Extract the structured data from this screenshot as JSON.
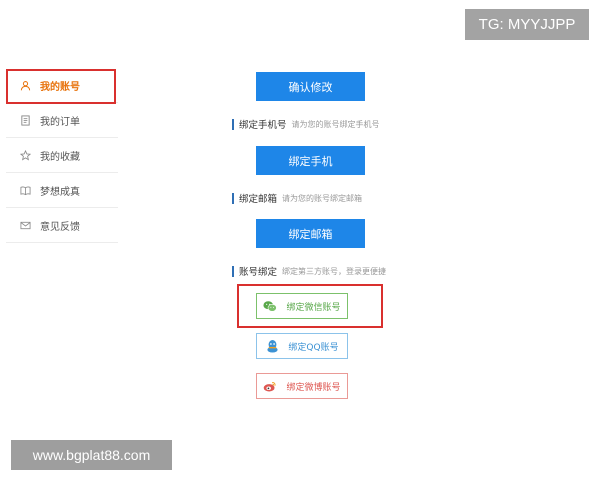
{
  "watermark": {
    "top": "TG: MYYJJPP",
    "bottom": "www.bgplat88.com"
  },
  "sidebar": {
    "items": [
      {
        "label": "我的账号",
        "icon": "user-icon",
        "active": true
      },
      {
        "label": "我的订单",
        "icon": "document-icon",
        "active": false
      },
      {
        "label": "我的收藏",
        "icon": "star-icon",
        "active": false
      },
      {
        "label": "梦想成真",
        "icon": "book-icon",
        "active": false
      },
      {
        "label": "意见反馈",
        "icon": "mail-icon",
        "active": false
      }
    ]
  },
  "main": {
    "confirm_button": "确认修改",
    "phone": {
      "title": "绑定手机号",
      "hint": "请为您的账号绑定手机号",
      "button": "绑定手机"
    },
    "email": {
      "title": "绑定邮箱",
      "hint": "请为您的账号绑定邮箱",
      "button": "绑定邮箱"
    },
    "social": {
      "title": "账号绑定",
      "hint": "绑定第三方账号，登录更便捷",
      "wechat": "绑定微信账号",
      "qq": "绑定QQ账号",
      "weibo": "绑定微博账号"
    }
  },
  "colors": {
    "accent_blue": "#1e86e8",
    "active_orange": "#e8740f",
    "highlight_red": "#d9302e",
    "wechat_green": "#59a84a",
    "qq_blue": "#3c92d4",
    "weibo_red": "#de5751"
  }
}
